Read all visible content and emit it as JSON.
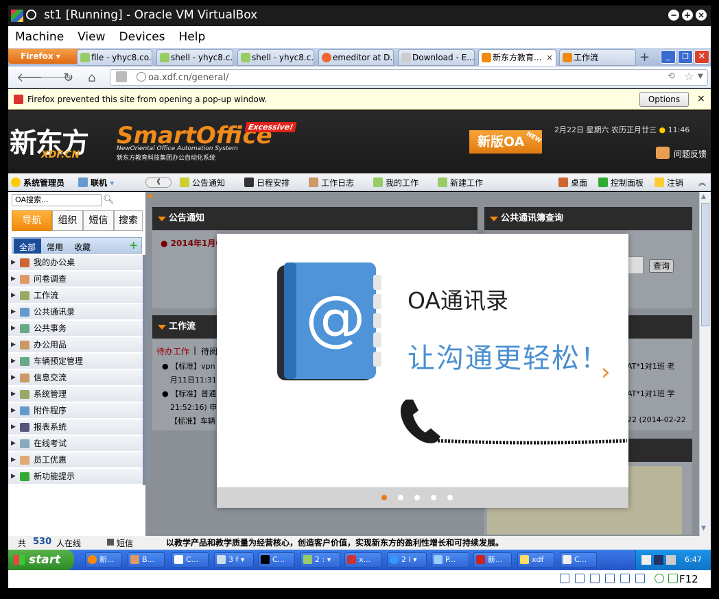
{
  "vbox": {
    "title": "st1 [Running] - Oracle VM VirtualBox",
    "menu": [
      "Machine",
      "View",
      "Devices",
      "Help"
    ],
    "host_key": "F12"
  },
  "firefox": {
    "button_label": "Firefox",
    "tabs": [
      {
        "label": "file - yhyc8.co...",
        "active": false
      },
      {
        "label": "shell - yhyc8.c...",
        "active": false
      },
      {
        "label": "shell - yhyc8.c...",
        "active": false
      },
      {
        "label": "emeditor at D...",
        "active": false
      },
      {
        "label": "Download - E...",
        "active": false
      },
      {
        "label": "新东方教育...",
        "active": true
      },
      {
        "label": "工作流",
        "active": false
      }
    ],
    "url": "oa.xdf.cn/general/",
    "popup_notice": "Firefox prevented this site from opening a pop-up window.",
    "options_label": "Options"
  },
  "header": {
    "logo_cn": "新东方",
    "logo_en": "XDF.CN",
    "product": "SmartOffice",
    "product_badge": "Excessive!",
    "product_sub_en": "NewOriental Office Automation System",
    "product_sub_cn": "新东方教育科技集团办公自动化系统",
    "new_oa": "新版OA",
    "new_badge": "NEW",
    "date": "2月22日 星期六 农历正月廿三",
    "time": "11:46",
    "feedback": "问题反馈"
  },
  "toolbar": {
    "user": "系统管理员",
    "status": "联机",
    "items": [
      "公告通知",
      "日程安排",
      "工作日志",
      "我的工作",
      "新建工作"
    ],
    "right_items": [
      "桌面",
      "控制面板",
      "注销"
    ]
  },
  "left": {
    "search_placeholder": "OA搜索...",
    "tabs": [
      "导航",
      "组织",
      "短信",
      "搜索"
    ],
    "subtabs": [
      "全部",
      "常用",
      "收藏"
    ],
    "tree": [
      "我的办公桌",
      "问卷调查",
      "工作流",
      "公共通讯录",
      "公共事务",
      "办公用品",
      "车辆预定管理",
      "信息交流",
      "系统管理",
      "附件程序",
      "报表系统",
      "在线考试",
      "员工优惠",
      "新功能提示"
    ]
  },
  "panels": {
    "notice_title": "公告通知",
    "notice_item": "2014年1月0",
    "contacts_title": "公共通讯簿查询",
    "query_button": "查询",
    "workflow_title": "工作流",
    "workflow_tabs": [
      "待办工作",
      "待阅"
    ],
    "workflow_rows": [
      "【标准】vpn",
      "月11日11:31",
      "【标准】普通",
      "21:52:16) 申",
      "【标准】车辆"
    ],
    "right_rows": [
      "AT*1对1班 老",
      "AT*1对1班 学",
      "22 (2014-02-22"
    ]
  },
  "modal": {
    "title": "OA通讯录",
    "slogan": "让沟通更轻松！",
    "slide_count": 5,
    "active_slide": 0
  },
  "status": {
    "online_prefix": "共",
    "online_count": "530",
    "online_suffix": "人在线",
    "sms": "短信",
    "motto": "以教学产品和教学质量为经营核心，创造客户价值，实现新东方的盈利性增长和可持续发展。"
  },
  "taskbar": {
    "start": "start",
    "items": [
      "新...",
      "B...",
      "C...",
      "3 f",
      "C...",
      "2 :",
      "x...",
      "2 l",
      "P...",
      "新...",
      "xdf",
      "C..."
    ],
    "clock": "6:47"
  }
}
